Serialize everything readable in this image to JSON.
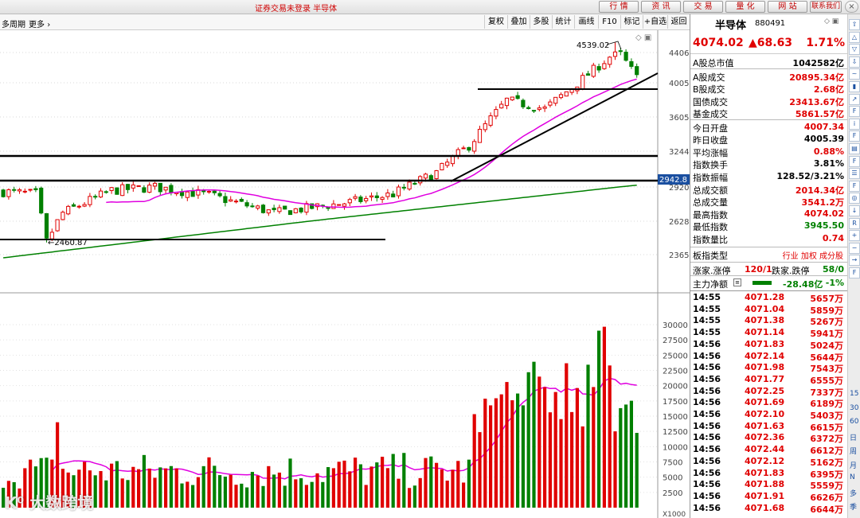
{
  "titlebar": {
    "title": "证券交易未登录  半导体",
    "buttons": [
      "行 情",
      "资 讯",
      "交 易",
      "量 化",
      "网 站",
      "联系我们"
    ],
    "window_controls": [
      "−",
      "□",
      "×"
    ]
  },
  "toolbar": {
    "period_label": "多周期",
    "more_label": "更多",
    "buttons": [
      "复权",
      "叠加",
      "多股",
      "统计",
      "画线",
      "F10",
      "标记",
      "+自选",
      "返回"
    ]
  },
  "sidebar": {
    "icons": [
      "arrow-up-icon",
      "arrow-up-outline-icon",
      "arrow-down-outline-icon",
      "arrow-down-icon",
      "minute-chart-icon",
      "kline-chart-icon",
      "trend-icon",
      "f10-icon",
      "info-icon",
      "f10-alt-icon",
      "table-icon",
      "f-icon",
      "list-icon",
      "f-alt-icon",
      "circle-icon",
      "arrow-small-icon",
      "rsi-icon",
      "plus-icon",
      "minus-icon",
      "arrow-right-icon",
      "f5-icon"
    ],
    "period_labels": [
      "15",
      "30",
      "60",
      "日",
      "周",
      "月",
      "N",
      "多",
      "季"
    ]
  },
  "panel": {
    "stock_name": "半导体",
    "stock_code": "880491",
    "price": "4074.02",
    "change": "▲68.63",
    "change_pct": "1.71%",
    "rows": [
      {
        "label": "A股总市值",
        "value": "1042582亿",
        "color": "k"
      },
      {
        "label": "A股成交",
        "value": "20895.34亿",
        "color": "r"
      },
      {
        "label": "B股成交",
        "value": "2.68亿",
        "color": "r"
      },
      {
        "label": "国债成交",
        "value": "23413.67亿",
        "color": "r"
      },
      {
        "label": "基金成交",
        "value": "5861.57亿",
        "color": "r"
      },
      {
        "label": "今日开盘",
        "value": "4007.34",
        "color": "r"
      },
      {
        "label": "昨日收盘",
        "value": "4005.39",
        "color": "k"
      },
      {
        "label": "平均涨幅",
        "value": "0.88%",
        "color": "r"
      },
      {
        "label": "指数换手",
        "value": "3.81%",
        "color": "k"
      },
      {
        "label": "指数振幅",
        "value": "128.52/3.21%",
        "color": "k"
      },
      {
        "label": "总成交额",
        "value": "2014.34亿",
        "color": "r"
      },
      {
        "label": "总成交量",
        "value": "3541.2万",
        "color": "r"
      },
      {
        "label": "最高指数",
        "value": "4074.02",
        "color": "r"
      },
      {
        "label": "最低指数",
        "value": "3945.50",
        "color": "g"
      },
      {
        "label": "指数量比",
        "value": "0.74",
        "color": "r"
      }
    ],
    "board_type_label": "板指类型",
    "board_type_links": "行业 加权 成分股",
    "zt_label": "涨家.涨停",
    "zt_value": "120/1",
    "dt_label": "跌家.跌停",
    "dt_value": "58/0",
    "flow_label": "主力净额",
    "flow_value": "-28.48亿",
    "flow_pct": "-1%",
    "ticks": [
      {
        "time": "14:55",
        "price": "4071.28",
        "vol": "5657万"
      },
      {
        "time": "14:55",
        "price": "4071.04",
        "vol": "5859万"
      },
      {
        "time": "14:55",
        "price": "4071.38",
        "vol": "5267万"
      },
      {
        "time": "14:55",
        "price": "4071.14",
        "vol": "5941万"
      },
      {
        "time": "14:56",
        "price": "4071.83",
        "vol": "5024万"
      },
      {
        "time": "14:56",
        "price": "4072.14",
        "vol": "5644万"
      },
      {
        "time": "14:56",
        "price": "4071.98",
        "vol": "7543万"
      },
      {
        "time": "14:56",
        "price": "4071.77",
        "vol": "6555万"
      },
      {
        "time": "14:56",
        "price": "4072.25",
        "vol": "7337万"
      },
      {
        "time": "14:56",
        "price": "4071.69",
        "vol": "6189万"
      },
      {
        "time": "14:56",
        "price": "4072.10",
        "vol": "5403万"
      },
      {
        "time": "14:56",
        "price": "4071.63",
        "vol": "6615万"
      },
      {
        "time": "14:56",
        "price": "4072.36",
        "vol": "6372万"
      },
      {
        "time": "14:56",
        "price": "4072.44",
        "vol": "6612万"
      },
      {
        "time": "14:56",
        "price": "4072.12",
        "vol": "5162万"
      },
      {
        "time": "14:56",
        "price": "4071.83",
        "vol": "6395万"
      },
      {
        "time": "14:56",
        "price": "4071.88",
        "vol": "5559万"
      },
      {
        "time": "14:56",
        "price": "4071.91",
        "vol": "6626万"
      },
      {
        "time": "14:56",
        "price": "4071.68",
        "vol": "6644万"
      }
    ]
  },
  "chart": {
    "price_axis_labels": [
      "4406",
      "4005",
      "3605",
      "3244",
      "2920",
      "2628",
      "2365"
    ],
    "volume_axis_labels": [
      "30000",
      "27500",
      "25000",
      "22500",
      "20000",
      "17500",
      "15000",
      "12500",
      "10000",
      "7500",
      "5000",
      "2500"
    ],
    "volume_unit": "X1000",
    "high_label": "4539.02",
    "low_label": "2460.87",
    "current_level": "2942.8",
    "colors": {
      "up": "#e00000",
      "down": "#008000",
      "ma_short": "#e000e0",
      "ma_long": "#008000"
    }
  },
  "watermark": "K⁰ 大数跨境"
}
